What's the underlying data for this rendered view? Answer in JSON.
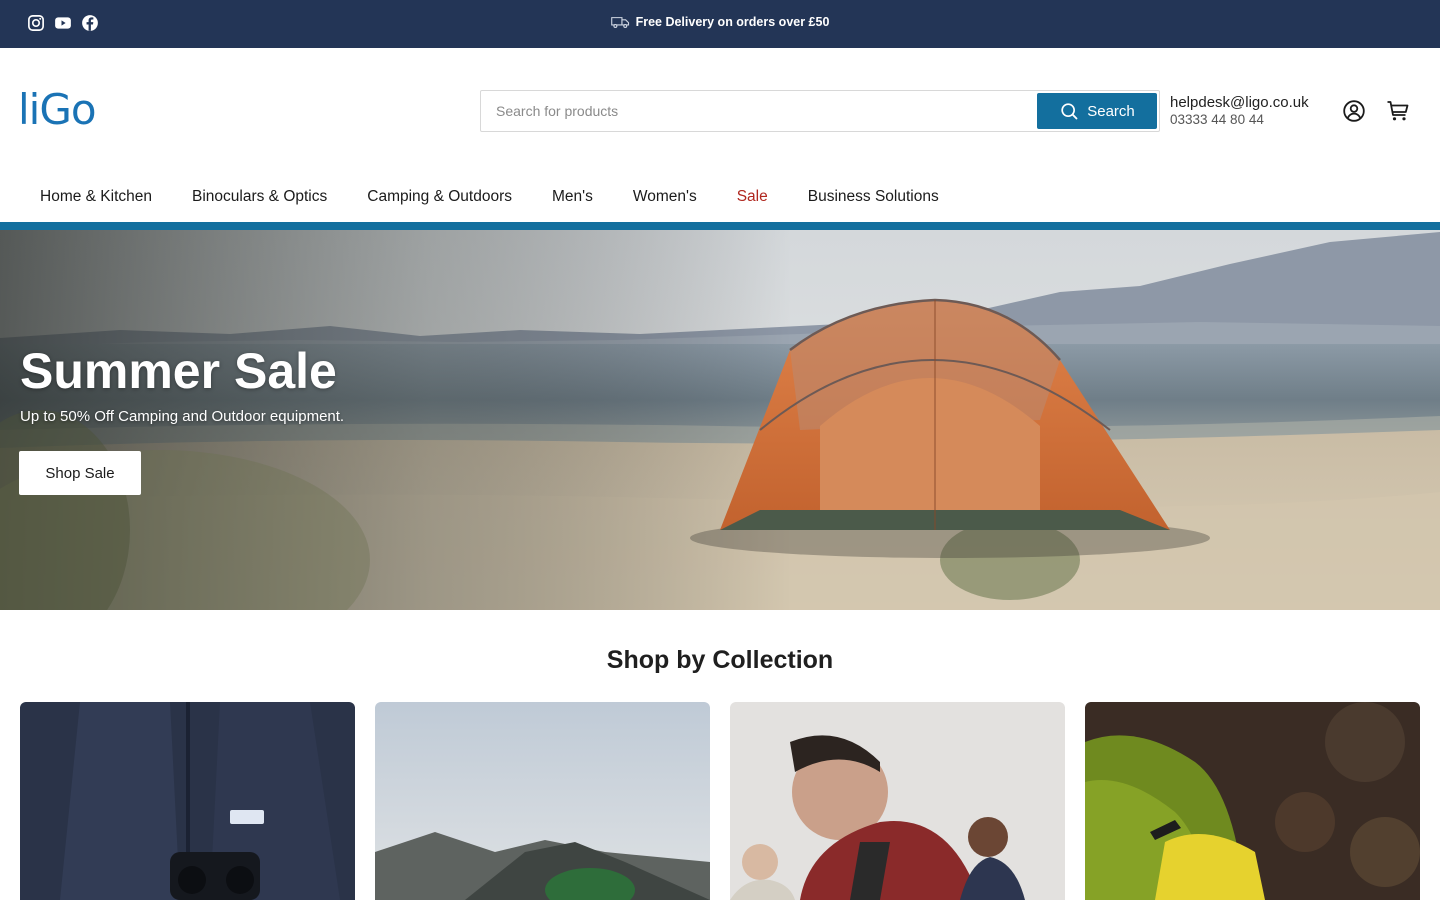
{
  "topbar": {
    "social": [
      {
        "icon": "instagram-icon"
      },
      {
        "icon": "youtube-icon"
      },
      {
        "icon": "facebook-icon"
      }
    ],
    "promo_text": "Free Delivery on orders over £50",
    "promo_icon": "truck-icon"
  },
  "header": {
    "logo": "liGo",
    "search": {
      "placeholder": "Search for products",
      "button_label": "Search"
    },
    "contact": {
      "email": "helpdesk@ligo.co.uk",
      "phone": "03333 44 80 44"
    },
    "icons": [
      "account-icon",
      "cart-icon"
    ]
  },
  "nav": {
    "items": [
      {
        "label": "Home & Kitchen"
      },
      {
        "label": "Binoculars & Optics"
      },
      {
        "label": "Camping & Outdoors"
      },
      {
        "label": "Men's"
      },
      {
        "label": "Women's"
      },
      {
        "label": "Sale"
      },
      {
        "label": "Business Solutions"
      }
    ],
    "sale_color": "#b0271f"
  },
  "hero": {
    "title": "Summer Sale",
    "subtitle": "Up to 50% Off Camping and Outdoor equipment.",
    "button_label": "Shop Sale"
  },
  "collections": {
    "title": "Shop by Collection"
  },
  "colors": {
    "topbar": "#233556",
    "accent": "#136f9e",
    "logo": "#1a73b5"
  }
}
